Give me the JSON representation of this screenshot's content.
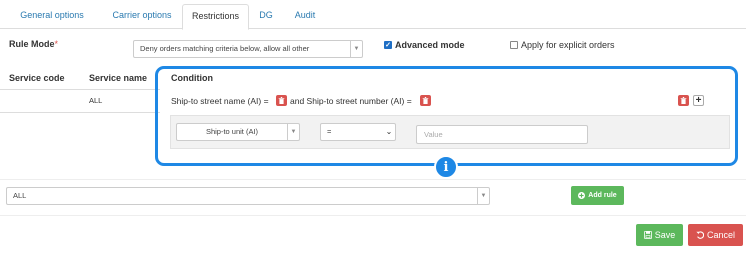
{
  "tabs": [
    {
      "label": "General options",
      "active": false
    },
    {
      "label": "Carrier options",
      "active": false
    },
    {
      "label": "Restrictions",
      "active": true
    },
    {
      "label": "DG",
      "active": false
    },
    {
      "label": "Audit",
      "active": false
    }
  ],
  "rule_mode": {
    "label": "Rule Mode",
    "required_mark": "*",
    "selected": "Deny orders matching criteria below, allow all other",
    "advanced_mode": {
      "label": "Advanced mode",
      "checked": true
    },
    "apply_explicit": {
      "label": "Apply for explicit orders",
      "checked": false
    }
  },
  "table": {
    "headers": {
      "service_code": "Service code",
      "service_name": "Service name",
      "condition": "Condition"
    },
    "row": {
      "service_name": "ALL",
      "condition_part1": "Ship-to street name (AI) =",
      "condition_part2": "and Ship-to street number (AI) ="
    }
  },
  "condition_editor": {
    "field_select": "Ship-to unit (AI)",
    "operator": "=",
    "value_placeholder": "Value"
  },
  "info_icon": "i",
  "bottom": {
    "service_select": "ALL",
    "add_rule_label": "Add rule",
    "save_label": "Save",
    "cancel_label": "Cancel"
  },
  "colors": {
    "highlight": "#1e88e5",
    "danger": "#d9534f",
    "success": "#5cb85c",
    "link": "#2a7ab0"
  }
}
